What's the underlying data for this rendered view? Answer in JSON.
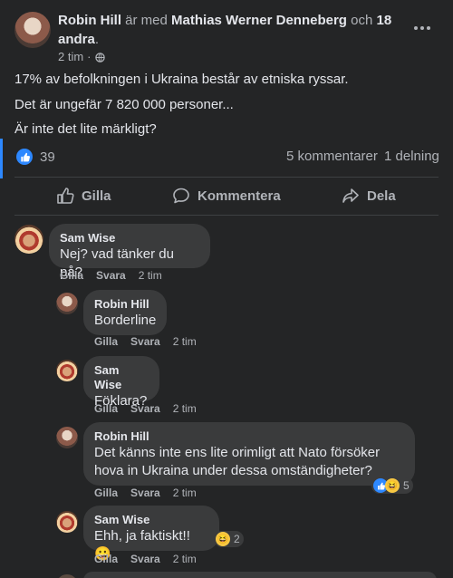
{
  "post": {
    "author": "Robin Hill",
    "with_text": "är med",
    "tagged": "Mathias Werner Denneberg",
    "and_text": "och",
    "others": "18 andra",
    "period": ".",
    "time": "2 tim",
    "dot": "·",
    "lines": [
      "17% av befolkningen i Ukraina består av etniska ryssar.",
      "Det är ungefär 7 820 000 personer...",
      "Är inte det lite märkligt?"
    ],
    "like_count": "39",
    "comments_count": "5 kommentarer",
    "shares_count": "1 delning"
  },
  "actions": {
    "like": "Gilla",
    "comment": "Kommentera",
    "share": "Dela"
  },
  "comments": [
    {
      "author": "Sam Wise",
      "text": "Nej? vad tänker du på?",
      "like": "Gilla",
      "reply": "Svara",
      "time": "2 tim"
    },
    {
      "author": "Robin Hill",
      "text": "Borderline",
      "like": "Gilla",
      "reply": "Svara",
      "time": "2 tim"
    },
    {
      "author": "Sam Wise",
      "text": "Föklara?",
      "like": "Gilla",
      "reply": "Svara",
      "time": "2 tim"
    },
    {
      "author": "Robin Hill",
      "text_line1": "Det känns inte ens lite orimligt att Nato försöker",
      "text_line2": "hova in Ukraina under dessa omständigheter?",
      "like": "Gilla",
      "reply": "Svara",
      "time": "2 tim",
      "reactions": "5"
    },
    {
      "author": "Sam Wise",
      "text": "Ehh, ja faktiskt!! 😀",
      "like": "Gilla",
      "reply": "Svara",
      "time": "2 tim",
      "reactions": "2"
    }
  ],
  "colors": {
    "background": "#242526",
    "bubble": "#3a3b3c",
    "like_blue": "#2d88ff",
    "accent_bar": "#2d88ff"
  }
}
